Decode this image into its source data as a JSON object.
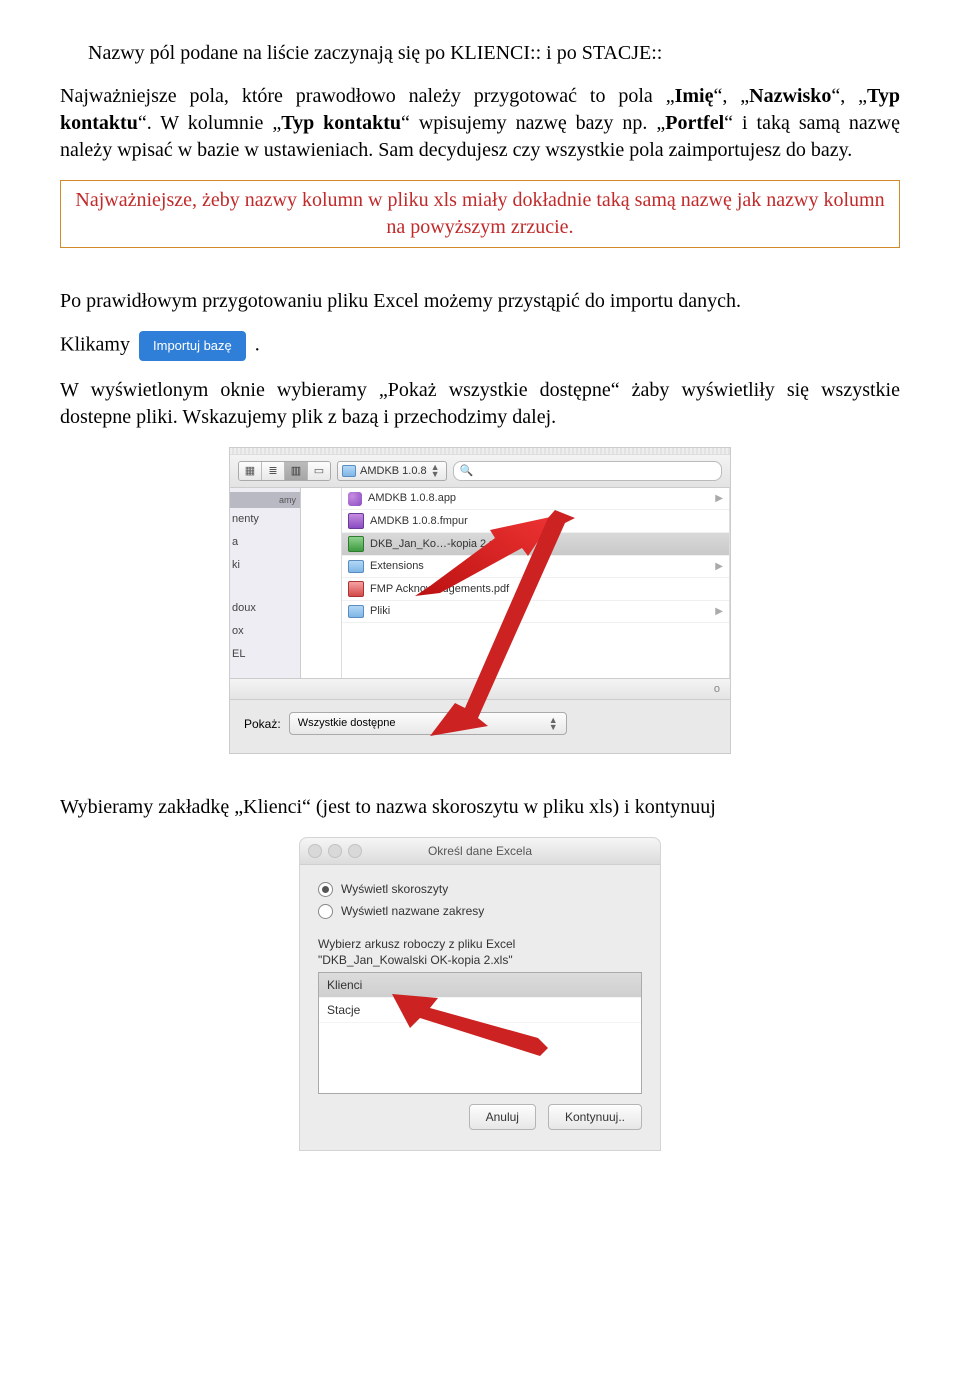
{
  "p1_a": "Nazwy pól podane na liście zaczynają się po KLIENCI:: i po STACJE::",
  "p2_a": "Najważniejsze pola, które prawodłowo należy przygotować to pola „",
  "p2_b": "Imię",
  "p2_c": "“, „",
  "p2_d": "Nazwisko",
  "p2_e": "“, „",
  "p2_f": "Typ kontaktu",
  "p2_g": "“. W kolumnie „",
  "p2_h": "Typ kontaktu",
  "p2_i": "“ wpisujemy nazwę bazy np. „",
  "p2_j": "Portfel",
  "p2_k": "“ i taką samą nazwę należy wpisać w bazie w ustawieniach. Sam decydujesz czy wszystkie pola zaimportujesz do bazy.",
  "callout": "Najważniejsze, żeby nazwy kolumn w pliku xls miały dokładnie taką samą nazwę jak nazwy kolumn na powyższym zrzucie.",
  "p3": "Po prawidłowym przygotowaniu pliku Excel możemy przystąpić do importu danych.",
  "p4_a": "Klikamy ",
  "import_btn": "Importuj bazę",
  "p4_b": ".",
  "p5": "W wyświetlonym oknie wybieramy „Pokaż wszystkie dostępne“ żaby wyświetliły się wszystkie dostepne pliki. Wskazujemy plik z bazą i przechodzimy dalej.",
  "dlg1": {
    "path": "AMDKB 1.0.8",
    "sidebar_header": "amy",
    "sidebar_items": [
      "nenty",
      "a",
      "ki",
      "doux",
      "ox",
      "EL"
    ],
    "files": [
      {
        "name": "AMDKB 1.0.8.app",
        "type": "app",
        "expand": true
      },
      {
        "name": "AMDKB 1.0.8.fmpur",
        "type": "fmp"
      },
      {
        "name": "DKB_Jan_Ko…-kopia 2.xls",
        "type": "xls",
        "selected": true
      },
      {
        "name": "Extensions",
        "type": "folder",
        "expand": true
      },
      {
        "name": "FMP Acknowledgements.pdf",
        "type": "pdf"
      },
      {
        "name": "Pliki",
        "type": "folder",
        "expand": true
      }
    ],
    "o_mark": "o",
    "show_label": "Pokaż:",
    "show_value": "Wszystkie dostępne"
  },
  "p6": "Wybieramy zakładkę „Klienci“ (jest to nazwa skoroszytu w pliku xls) i kontynuuj",
  "dlg2": {
    "title": "Określ dane Excela",
    "radio1": "Wyświetl skoroszyty",
    "radio2": "Wyświetl nazwane zakresy",
    "instr_a": "Wybierz arkusz roboczy z pliku Excel",
    "instr_b": "\"DKB_Jan_Kowalski OK-kopia 2.xls\"",
    "list": [
      "Klienci",
      "Stacje"
    ],
    "cancel": "Anuluj",
    "ok": "Kontynuuj.."
  }
}
